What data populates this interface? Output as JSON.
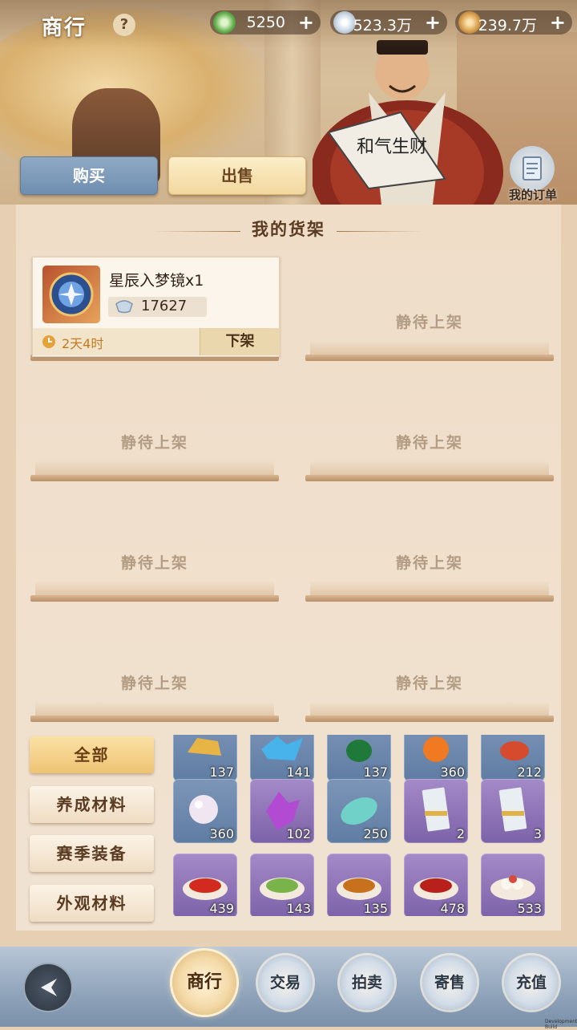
{
  "header": {
    "title": "商行",
    "help_label": "?",
    "currencies": [
      {
        "icon": "jade-icon",
        "value": "5250",
        "plus": "+"
      },
      {
        "icon": "silver-ingot-icon",
        "value": "523.3万",
        "plus": "+"
      },
      {
        "icon": "copper-coin-icon",
        "value": "239.7万",
        "plus": "+"
      }
    ]
  },
  "tabs": {
    "buy": "购买",
    "sell": "出售"
  },
  "orders": {
    "label": "我的订单"
  },
  "shelf": {
    "title": "我的货架",
    "listing": {
      "name": "星辰入梦镜x1",
      "price": "17627",
      "time_left": "2天4时",
      "delist_label": "下架"
    },
    "empty_label": "静待上架"
  },
  "categories": [
    "全部",
    "养成材料",
    "赛季装备",
    "外观材料"
  ],
  "inventory": [
    {
      "icon": "gold-bar-icon",
      "count": "137"
    },
    {
      "icon": "blue-crystal-icon",
      "count": "141"
    },
    {
      "icon": "green-gourd-icon",
      "count": "137"
    },
    {
      "icon": "orange-fruit-icon",
      "count": "360"
    },
    {
      "icon": "red-gem-icon",
      "count": "212"
    },
    {
      "icon": "pearl-icon",
      "count": "360"
    },
    {
      "icon": "purple-crystal-icon",
      "count": "102"
    },
    {
      "icon": "jade-stone-icon",
      "count": "250"
    },
    {
      "icon": "voucher-bundle-icon",
      "count": "2"
    },
    {
      "icon": "voucher-bundle-icon",
      "count": "3"
    },
    {
      "icon": "chili-dish-icon",
      "count": "439"
    },
    {
      "icon": "green-vegetable-dish-icon",
      "count": "143"
    },
    {
      "icon": "braised-meat-dish-icon",
      "count": "135"
    },
    {
      "icon": "red-berry-dish-icon",
      "count": "478"
    },
    {
      "icon": "dumpling-dish-icon",
      "count": "533"
    }
  ],
  "bottom_nav": {
    "back": "back-arrow-icon",
    "items": [
      "商行",
      "交易",
      "拍卖",
      "寄售",
      "充值"
    ]
  },
  "dev_tag": "Development Build"
}
